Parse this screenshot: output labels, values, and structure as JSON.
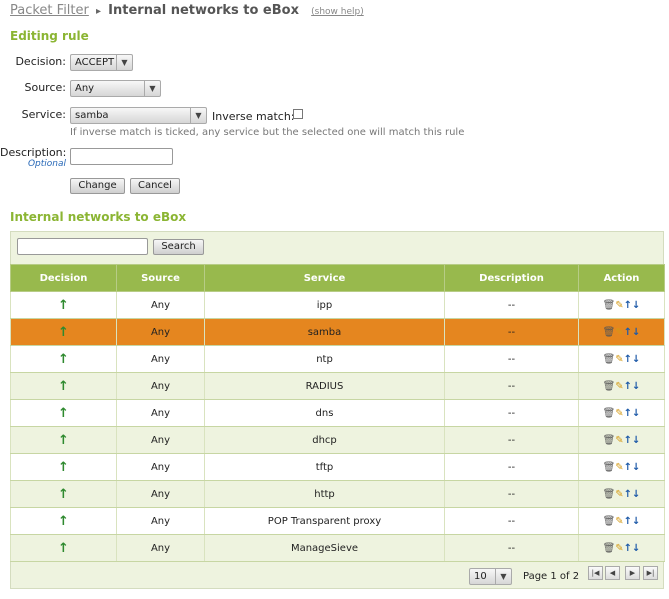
{
  "breadcrumb": {
    "parent": "Packet Filter",
    "separator": "▸",
    "current": "Internal networks to eBox",
    "help": "(show help)"
  },
  "editing": {
    "title": "Editing rule",
    "decision_label": "Decision:",
    "decision_value": "ACCEPT",
    "source_label": "Source:",
    "source_value": "Any",
    "service_label": "Service:",
    "service_value": "samba",
    "inverse_label": "Inverse match:",
    "inverse_checked": false,
    "hint": "If inverse match is ticked, any service but the selected one will match this rule",
    "description_label": "Description:",
    "description_optional": "Optional",
    "description_value": "",
    "change_button": "Change",
    "cancel_button": "Cancel"
  },
  "table": {
    "title": "Internal networks to eBox",
    "search_button": "Search",
    "search_value": "",
    "columns": [
      "Decision",
      "Source",
      "Service",
      "Description",
      "Action"
    ],
    "rows": [
      {
        "decision": "↑",
        "source": "Any",
        "service": "ipp",
        "description": "--"
      },
      {
        "decision": "↑",
        "source": "Any",
        "service": "samba",
        "description": "--",
        "selected": true
      },
      {
        "decision": "↑",
        "source": "Any",
        "service": "ntp",
        "description": "--"
      },
      {
        "decision": "↑",
        "source": "Any",
        "service": "RADIUS",
        "description": "--"
      },
      {
        "decision": "↑",
        "source": "Any",
        "service": "dns",
        "description": "--"
      },
      {
        "decision": "↑",
        "source": "Any",
        "service": "dhcp",
        "description": "--"
      },
      {
        "decision": "↑",
        "source": "Any",
        "service": "tftp",
        "description": "--"
      },
      {
        "decision": "↑",
        "source": "Any",
        "service": "http",
        "description": "--"
      },
      {
        "decision": "↑",
        "source": "Any",
        "service": "POP Transparent proxy",
        "description": "--"
      },
      {
        "decision": "↑",
        "source": "Any",
        "service": "ManageSieve",
        "description": "--"
      }
    ],
    "action_icons": [
      "trash-icon",
      "pencil-icon",
      "arrow-up-icon",
      "arrow-down-icon"
    ],
    "page_size": "10",
    "page_info": "Page 1 of 2"
  },
  "colors": {
    "accent": "#8bb533",
    "header_bg": "#98b94d",
    "selected_row": "#e5861f",
    "decision_arrow": "#2f8a2f",
    "move_arrow": "#1e5aa8"
  }
}
